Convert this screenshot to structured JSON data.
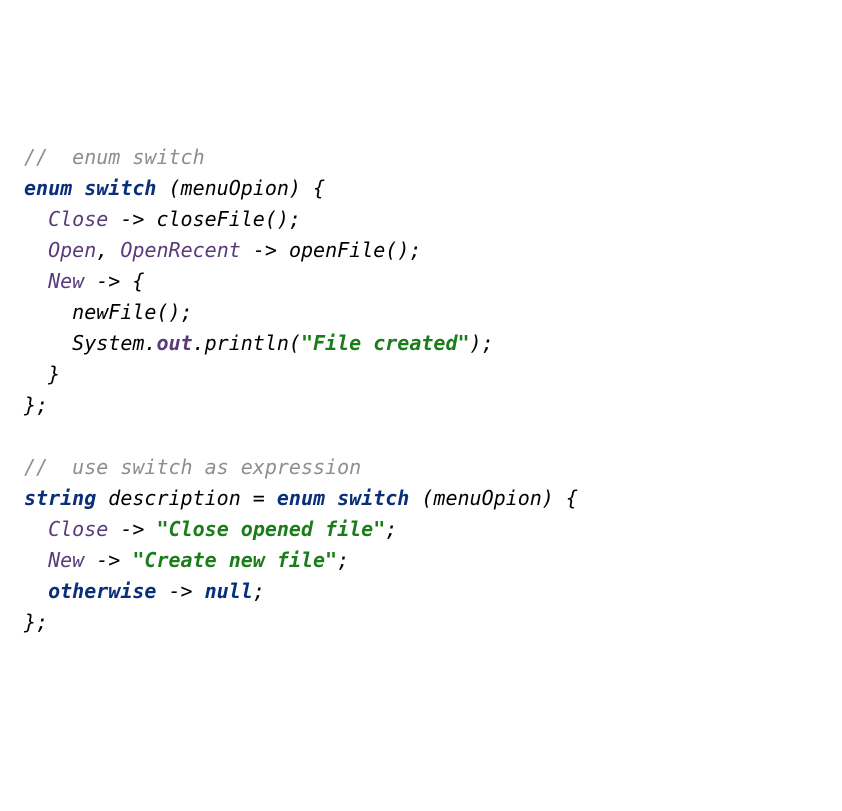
{
  "lines": {
    "l1": {
      "c1": "//  enum switch"
    },
    "l2": {
      "kw1": "enum",
      "kw2": "switch",
      "rest": " (menuOpion) {"
    },
    "l3": {
      "indent": "  ",
      "ec": "Close",
      "rest": " -> closeFile();"
    },
    "l4": {
      "indent": "  ",
      "ec1": "Open",
      "sep": ", ",
      "ec2": "OpenRecent",
      "rest": " -> openFile();"
    },
    "l5": {
      "indent": "  ",
      "ec": "New",
      "rest": " -> {"
    },
    "l6": {
      "text": "    newFile();"
    },
    "l7": {
      "indent": "    ",
      "p1": "System.",
      "fld": "out",
      "p2": ".println(",
      "str": "\"File created\"",
      "p3": ");"
    },
    "l8": {
      "text": "  }"
    },
    "l9": {
      "text": "};"
    },
    "blank": {
      "text": " "
    },
    "l10": {
      "c1": "//  use switch as expression"
    },
    "l11": {
      "kw1": "string",
      "mid": " description = ",
      "kw2": "enum",
      "kw3": "switch",
      "rest": " (menuOpion) {"
    },
    "l12": {
      "indent": "  ",
      "ec": "Close",
      "arrow": " -> ",
      "str": "\"Close opened file\"",
      "semi": ";"
    },
    "l13": {
      "indent": "  ",
      "ec": "New",
      "arrow": " -> ",
      "str": "\"Create new file\"",
      "semi": ";"
    },
    "l14": {
      "indent": "  ",
      "kw1": "otherwise",
      "arrow": " -> ",
      "kw2": "null",
      "semi": ";"
    },
    "l15": {
      "text": "};"
    }
  }
}
